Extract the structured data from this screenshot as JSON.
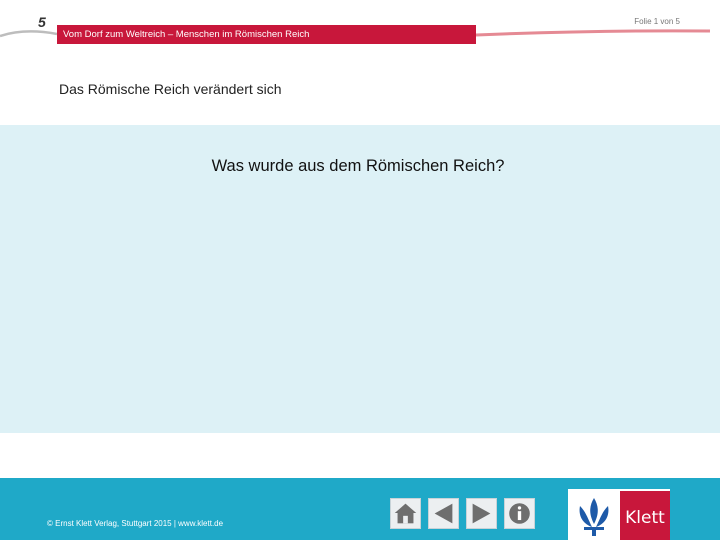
{
  "header": {
    "chapter_number": "5",
    "slide_counter": "Folie 1 von 5",
    "band_text": "Vom Dorf zum Weltreich – Menschen im Römischen Reich"
  },
  "content": {
    "section_title": "Das Römische Reich verändert sich",
    "question": "Was wurde aus dem Römischen Reich?"
  },
  "footer": {
    "copyright": "© Ernst Klett Verlag, Stuttgart 2015 | www.klett.de",
    "nav_icons": [
      "home-icon",
      "previous-icon",
      "next-icon",
      "info-icon"
    ],
    "logo_text": "Klett"
  },
  "colors": {
    "brand_red": "#c8173b",
    "footer_blue": "#1fa9c8",
    "content_bg": "#ddf1f6"
  }
}
